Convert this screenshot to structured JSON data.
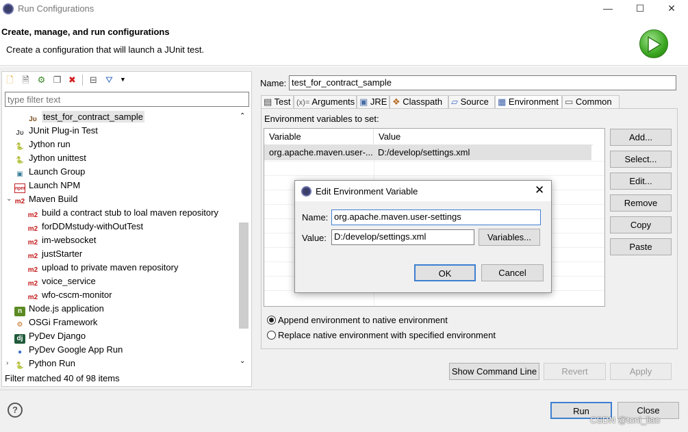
{
  "window": {
    "title": "Run Configurations",
    "minimize": "—",
    "maximize": "☐",
    "close": "✕"
  },
  "header": {
    "title": "Create, manage, and run configurations",
    "description": "Create a configuration that will launch a JUnit test."
  },
  "filter": {
    "placeholder": "type filter text"
  },
  "tree": {
    "items": [
      {
        "label": "test_for_contract_sample",
        "icon": "junit-icon",
        "indent": 2,
        "selected": true
      },
      {
        "label": "JUnit Plug-in Test",
        "icon": "junit-plugin-icon",
        "indent": 1
      },
      {
        "label": "Jython run",
        "icon": "jython-icon",
        "indent": 1
      },
      {
        "label": "Jython unittest",
        "icon": "jython-icon",
        "indent": 1
      },
      {
        "label": "Launch Group",
        "icon": "launch-group-icon",
        "indent": 1
      },
      {
        "label": "Launch NPM",
        "icon": "npm-icon",
        "indent": 1
      },
      {
        "label": "Maven Build",
        "icon": "m2-icon",
        "indent": 1,
        "expanded": true
      },
      {
        "label": "build a contract stub to loal maven repository",
        "icon": "m2-icon",
        "indent": 2
      },
      {
        "label": "forDDMstudy-withOutTest",
        "icon": "m2-icon",
        "indent": 2
      },
      {
        "label": "im-websocket",
        "icon": "m2-icon",
        "indent": 2
      },
      {
        "label": "justStarter",
        "icon": "m2-icon",
        "indent": 2
      },
      {
        "label": "upload to private maven repository",
        "icon": "m2-icon",
        "indent": 2
      },
      {
        "label": "voice_service",
        "icon": "m2-icon",
        "indent": 2
      },
      {
        "label": "wfo-cscm-monitor",
        "icon": "m2-icon",
        "indent": 2
      },
      {
        "label": "Node.js application",
        "icon": "nodejs-icon",
        "indent": 1
      },
      {
        "label": "OSGi Framework",
        "icon": "osgi-icon",
        "indent": 1
      },
      {
        "label": "PyDev Django",
        "icon": "django-icon",
        "indent": 1
      },
      {
        "label": "PyDev Google App Run",
        "icon": "google-app-icon",
        "indent": 1
      },
      {
        "label": "Python Run",
        "icon": "python-icon",
        "indent": 1,
        "collapsed": true
      }
    ],
    "status": "Filter matched 40 of 98 items"
  },
  "config": {
    "name_label": "Name:",
    "name_value": "test_for_contract_sample",
    "tabs": [
      "Test",
      "Arguments",
      "JRE",
      "Classpath",
      "Source",
      "Environment",
      "Common"
    ],
    "active_tab": "Environment",
    "env_label": "Environment variables to set:",
    "columns": [
      "Variable",
      "Value"
    ],
    "rows": [
      {
        "variable": "org.apache.maven.user-...",
        "value": "D:/develop/settings.xml"
      }
    ],
    "side_buttons": [
      "Add...",
      "Select...",
      "Edit...",
      "Remove",
      "Copy",
      "Paste"
    ],
    "radio_append": "Append environment to native environment",
    "radio_replace": "Replace native environment with specified environment",
    "show_cmd": "Show Command Line",
    "revert": "Revert",
    "apply": "Apply"
  },
  "bottom": {
    "help": "?",
    "run": "Run",
    "close": "Close",
    "watermark": "CSDN @toni_liao"
  },
  "dialog": {
    "title": "Edit Environment Variable",
    "name_label": "Name:",
    "name_value": "org.apache.maven.user-settings",
    "value_label": "Value:",
    "value_value": "D:/develop/settings.xml",
    "variables_btn": "Variables...",
    "ok": "OK",
    "cancel": "Cancel"
  },
  "colors": {
    "accent": "#3c7fd1",
    "run_green": "#39a51f",
    "m2_red": "#c41a1a"
  }
}
